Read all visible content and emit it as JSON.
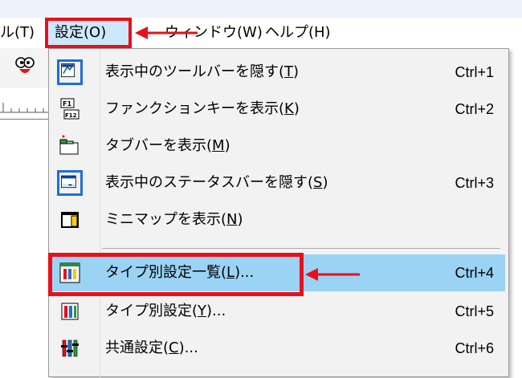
{
  "menubar": {
    "items": [
      {
        "label": "ル(T)"
      },
      {
        "label": "設定(O)"
      },
      {
        "label": "ウィンドウ(W)"
      },
      {
        "label": "ヘルプ(H)"
      }
    ]
  },
  "dropdown": {
    "items": [
      {
        "label_pre": "表示中のツールバーを隠す(",
        "accel": "T",
        "label_post": ")",
        "shortcut": "Ctrl+1",
        "icon": "toolbar-icon"
      },
      {
        "label_pre": "ファンクションキーを表示(",
        "accel": "K",
        "label_post": ")",
        "shortcut": "Ctrl+2",
        "icon": "function-key-icon"
      },
      {
        "label_pre": "タブバーを表示(",
        "accel": "M",
        "label_post": ")",
        "shortcut": "",
        "icon": "tabbar-icon"
      },
      {
        "label_pre": "表示中のステータスバーを隠す(",
        "accel": "S",
        "label_post": ")",
        "shortcut": "Ctrl+3",
        "icon": "statusbar-icon"
      },
      {
        "label_pre": "ミニマップを表示(",
        "accel": "N",
        "label_post": ")",
        "shortcut": "",
        "icon": "minimap-icon"
      },
      {
        "label_pre": "タイプ別設定一覧(",
        "accel": "L",
        "label_post": ")...",
        "shortcut": "Ctrl+4",
        "icon": "type-settings-list-icon"
      },
      {
        "label_pre": "タイプ別設定(",
        "accel": "Y",
        "label_post": ")...",
        "shortcut": "Ctrl+5",
        "icon": "type-settings-icon"
      },
      {
        "label_pre": "共通設定(",
        "accel": "C",
        "label_post": ")...",
        "shortcut": "Ctrl+6",
        "icon": "common-settings-icon"
      }
    ]
  },
  "colors": {
    "highlight": "#9bd3f5",
    "annotation_red": "#e8101b",
    "icon_frame": "#1d6fd6"
  }
}
